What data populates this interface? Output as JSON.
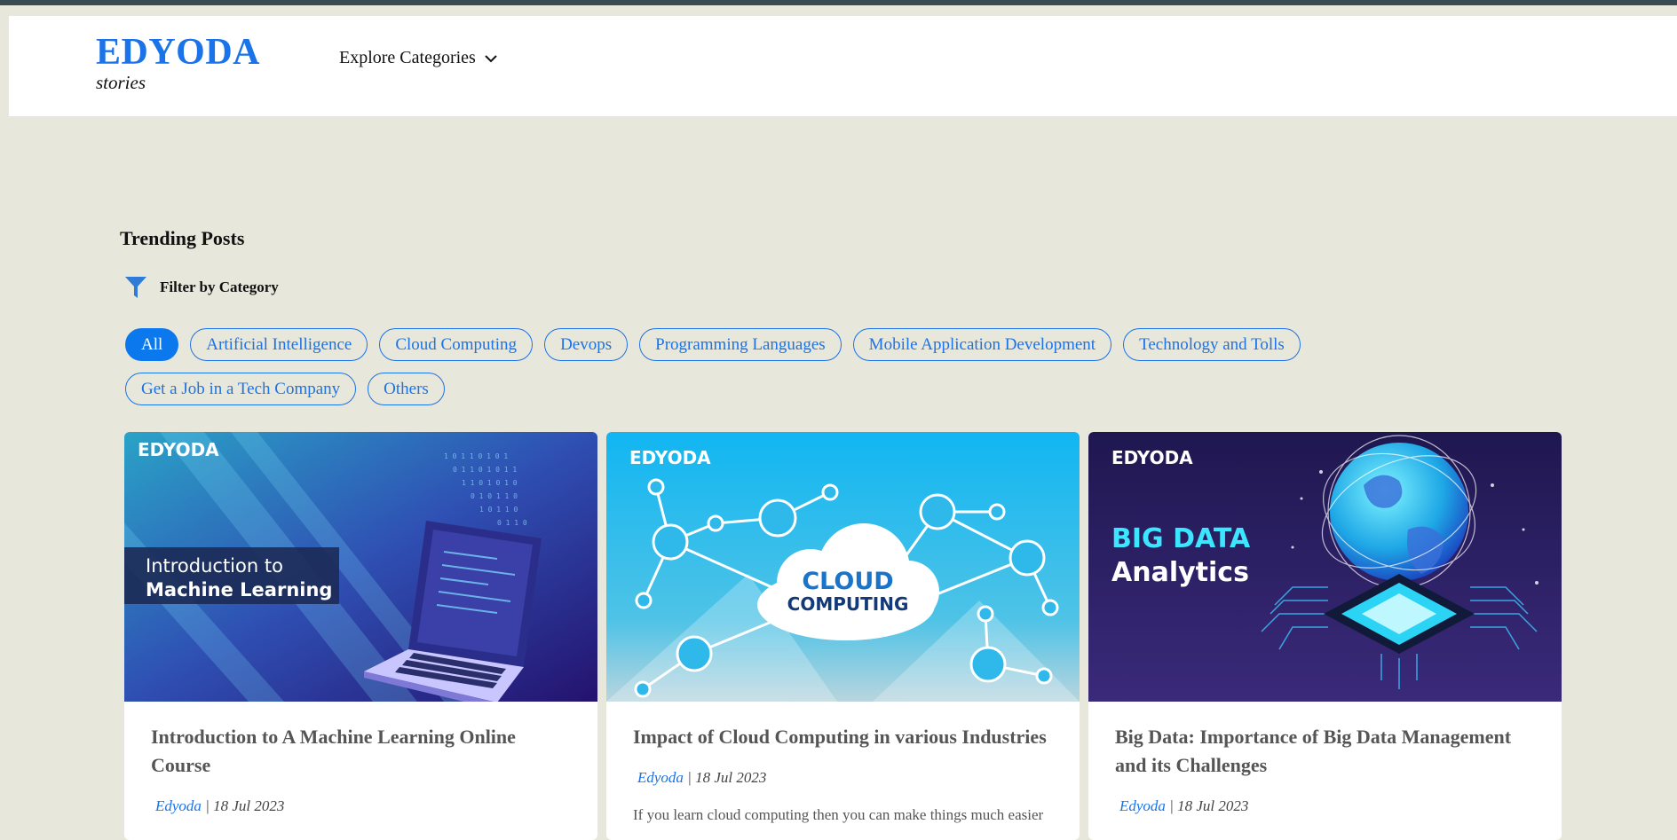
{
  "header": {
    "brand_name": "EDYODA",
    "brand_sub": "stories",
    "explore_label": "Explore Categories"
  },
  "section": {
    "title": "Trending Posts",
    "filter_label": "Filter by Category"
  },
  "categories": [
    "All",
    "Artificial Intelligence",
    "Cloud Computing",
    "Devops",
    "Programming Languages",
    "Mobile Application Development",
    "Technology and Tolls",
    "Get a Job in a Tech Company",
    "Others"
  ],
  "active_category": "All",
  "posts": [
    {
      "image_brand": "EDYODA",
      "image_line1": "Introduction to",
      "image_line2": "Machine Learning",
      "title": "Introduction to A Machine Learning Online Course",
      "author": "Edyoda",
      "date": "18 Jul 2023"
    },
    {
      "image_brand": "EDYODA",
      "image_line1": "CLOUD",
      "image_line2": "COMPUTING",
      "title": "Impact of Cloud Computing in various Industries",
      "author": "Edyoda",
      "date": "18 Jul 2023",
      "excerpt": "If you learn cloud computing then you can make things much easier"
    },
    {
      "image_brand": "EDYODA",
      "image_line1": "BIG DATA",
      "image_line2": "Analytics",
      "title": "Big Data: Importance of Big Data Management and its Challenges",
      "author": "Edyoda",
      "date": "18 Jul 2023"
    }
  ],
  "colors": {
    "accent": "#1a73e8",
    "page_bg": "#e8e7dc"
  }
}
